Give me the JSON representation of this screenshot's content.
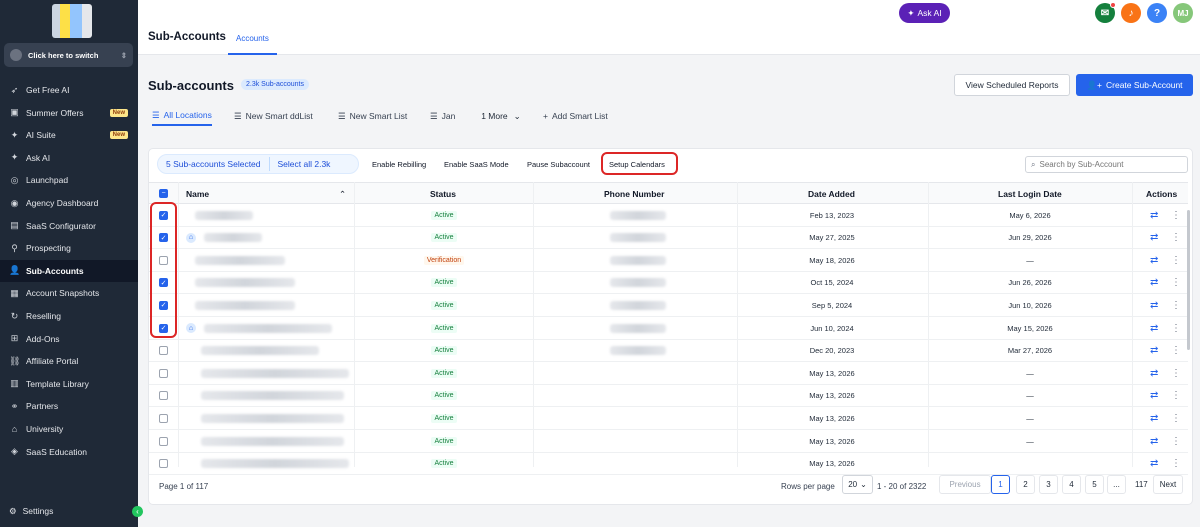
{
  "colors": {
    "sidebar": "#1f2937",
    "accent": "#2563eb",
    "active_status": "#15803d",
    "verification_status": "#c2410c",
    "highlight": "#dc2626"
  },
  "sidebar": {
    "switch_label": "Click here to switch",
    "items": [
      {
        "label": "Get Free AI",
        "icon": "rocket-icon"
      },
      {
        "label": "Summer Offers",
        "icon": "gift-icon",
        "badge": "New"
      },
      {
        "label": "AI Suite",
        "icon": "sparkle-icon",
        "badge": "New"
      },
      {
        "label": "Ask AI",
        "icon": "sparkle-icon"
      },
      {
        "label": "Launchpad",
        "icon": "launchpad-icon"
      },
      {
        "label": "Agency Dashboard",
        "icon": "dashboard-icon"
      },
      {
        "label": "SaaS Configurator",
        "icon": "chart-icon"
      },
      {
        "label": "Prospecting",
        "icon": "search-user-icon"
      },
      {
        "label": "Sub-Accounts",
        "icon": "user-icon",
        "active": true
      },
      {
        "label": "Account Snapshots",
        "icon": "snapshot-icon"
      },
      {
        "label": "Reselling",
        "icon": "refresh-icon"
      },
      {
        "label": "Add-Ons",
        "icon": "addons-icon"
      },
      {
        "label": "Affiliate Portal",
        "icon": "affiliate-icon"
      },
      {
        "label": "Template Library",
        "icon": "template-icon"
      },
      {
        "label": "Partners",
        "icon": "handshake-icon"
      },
      {
        "label": "University",
        "icon": "university-icon"
      },
      {
        "label": "SaaS Education",
        "icon": "education-icon"
      }
    ],
    "settings_label": "Settings"
  },
  "topbar": {
    "title": "Sub-Accounts",
    "tab": "Accounts",
    "ask_ai": "Ask AI",
    "avatar_initials": "MJ"
  },
  "page": {
    "title": "Sub-accounts",
    "count_badge": "2.3k Sub-accounts",
    "view_scheduled": "View Scheduled Reports",
    "create": "Create Sub-Account"
  },
  "smart_lists": {
    "all": "All Locations",
    "list1": "New Smart ddList",
    "list2": "New Smart List",
    "list3": "Jan",
    "more": "1 More",
    "add": "Add Smart List"
  },
  "bulk": {
    "selected": "5 Sub-accounts Selected",
    "select_all": "Select all 2.3k",
    "enable_rebilling": "Enable Rebilling",
    "enable_saas": "Enable SaaS Mode",
    "pause": "Pause Subaccount",
    "setup_calendars": "Setup Calendars"
  },
  "search": {
    "placeholder": "Search by Sub-Account"
  },
  "table": {
    "columns": {
      "name": "Name",
      "status": "Status",
      "phone": "Phone Number",
      "date_added": "Date Added",
      "last_login": "Last Login Date",
      "actions": "Actions"
    },
    "rows": [
      {
        "checked": true,
        "status": "Active",
        "date_added": "Feb 13, 2023",
        "last_login": "May 6, 2026"
      },
      {
        "checked": true,
        "status": "Active",
        "date_added": "May 27, 2025",
        "last_login": "Jun 29, 2026"
      },
      {
        "checked": false,
        "status": "Verification",
        "date_added": "May 18, 2026",
        "last_login": "—"
      },
      {
        "checked": true,
        "status": "Active",
        "date_added": "Oct 15, 2024",
        "last_login": "Jun 26, 2026"
      },
      {
        "checked": true,
        "status": "Active",
        "date_added": "Sep 5, 2024",
        "last_login": "Jun 10, 2026"
      },
      {
        "checked": true,
        "status": "Active",
        "date_added": "Jun 10, 2024",
        "last_login": "May 15, 2026"
      },
      {
        "checked": false,
        "status": "Active",
        "date_added": "Dec 20, 2023",
        "last_login": "Mar 27, 2026"
      },
      {
        "checked": false,
        "status": "Active",
        "date_added": "May 13, 2026",
        "last_login": "—"
      },
      {
        "checked": false,
        "status": "Active",
        "date_added": "May 13, 2026",
        "last_login": "—"
      },
      {
        "checked": false,
        "status": "Active",
        "date_added": "May 13, 2026",
        "last_login": "—"
      },
      {
        "checked": false,
        "status": "Active",
        "date_added": "May 13, 2026",
        "last_login": "—"
      },
      {
        "checked": false,
        "status": "Active",
        "date_added": "May 13, 2026",
        "last_login": ""
      }
    ]
  },
  "footer": {
    "page_info": "Page 1 of 117",
    "rows_per_page": "Rows per page",
    "rows_value": "20",
    "range": "1 - 20 of 2322",
    "previous": "Previous",
    "pages": [
      "1",
      "2",
      "3",
      "4",
      "5",
      "...",
      "117"
    ],
    "next": "Next"
  }
}
